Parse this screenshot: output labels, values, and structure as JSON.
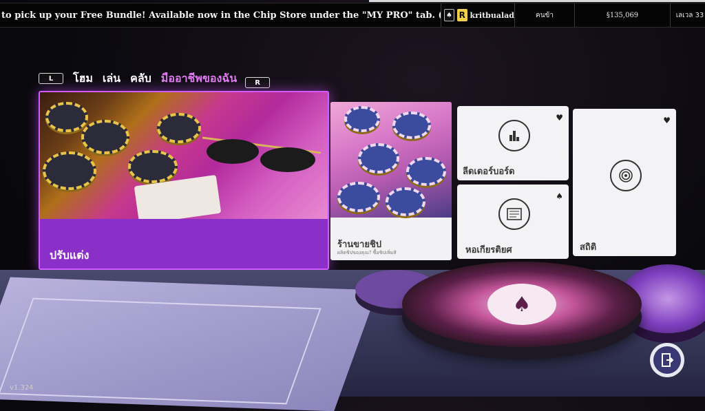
{
  "ticker": {
    "text": "to pick up your Free Bundle! Available now in the Chip Store under the \"MY PRO\" tab. (*not available on Ni"
  },
  "header": {
    "username": "kritbualad",
    "rank_label": "คนข้า",
    "balance": "§135,069",
    "level": "เลเวล 33",
    "club_icon": "spade-icon",
    "avatar_letter": "R"
  },
  "nav": {
    "left_bumper": "L",
    "right_bumper": "R",
    "tabs": [
      "โฮม",
      "เล่น",
      "คลับ",
      "มืออาชีพของฉัน"
    ],
    "active_tab": 3,
    "active_color": "#e07cf0"
  },
  "cards": {
    "customize": {
      "label": "ปรับแต่ง"
    },
    "chip_store": {
      "title": "ร้านขายชิป",
      "subtitle": "ผลิตชิปของคุณ? ซื้อชิปเพิ่มสิ"
    },
    "leaderboard": {
      "label": "ลีดเดอร์บอร์ด",
      "mark": "♥"
    },
    "hall_of_fame": {
      "label": "หอเกียรติยศ",
      "mark": "♠"
    },
    "stats": {
      "label": "สถิติ",
      "mark": "♥"
    }
  },
  "footer": {
    "version": "v1.324"
  },
  "colors": {
    "accent": "#d25bff",
    "card_bg": "#f3f3f5",
    "topbar": "#050506"
  }
}
